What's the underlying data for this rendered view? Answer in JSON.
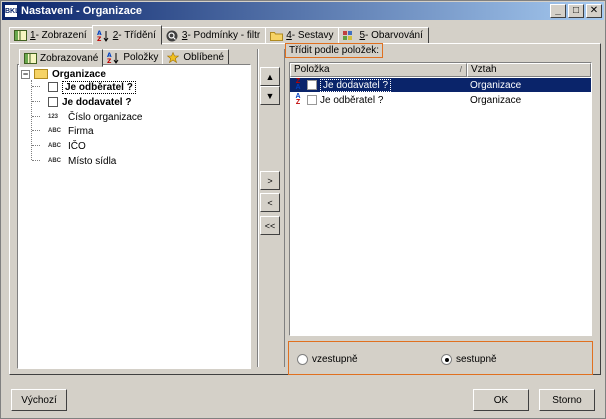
{
  "window": {
    "title": "Nastavení - Organizace",
    "app_icon": "BKL"
  },
  "tabs": [
    {
      "key": "1",
      "label": "- Zobrazení",
      "icon": "columns-icon"
    },
    {
      "key": "2",
      "label": "- Třídění",
      "icon": "sort-az-icon",
      "active": true
    },
    {
      "key": "3",
      "label": "- Podmínky - filtr",
      "icon": "filter-icon"
    },
    {
      "key": "4",
      "label": "- Sestavy",
      "icon": "report-folder-icon"
    },
    {
      "key": "5",
      "label": "- Obarvování",
      "icon": "color-palette-icon"
    }
  ],
  "subtabs": [
    {
      "label": "Zobrazované",
      "active": true
    },
    {
      "label": "Položky"
    },
    {
      "label": "Oblíbené"
    }
  ],
  "tree": {
    "root": "Organizace",
    "items": [
      {
        "label": "Je odběratel ?",
        "kind": "checkbox",
        "bold": true,
        "focused": true
      },
      {
        "label": "Je dodavatel ?",
        "kind": "checkbox",
        "bold": true
      },
      {
        "label": "Číslo organizace",
        "kind": "123"
      },
      {
        "label": "Firma",
        "kind": "ABC"
      },
      {
        "label": "IČO",
        "kind": "ABC"
      },
      {
        "label": "Místo sídla",
        "kind": "ABC"
      }
    ]
  },
  "middle_buttons": {
    "up": "▲",
    "down": "▼",
    "add": ">",
    "remove": "<",
    "remove_all": "<<"
  },
  "sort": {
    "label": "Třídit podle položek:",
    "columns": [
      "Položka",
      "Vztah"
    ],
    "rows": [
      {
        "item": "Je dodavatel ?",
        "relation": "Organizace",
        "direction": "desc",
        "selected": true
      },
      {
        "item": "Je odběratel ?",
        "relation": "Organizace",
        "direction": "asc",
        "selected": false
      }
    ],
    "order_options": [
      {
        "label": "vzestupně",
        "checked": false
      },
      {
        "label": "sestupně",
        "checked": true
      }
    ]
  },
  "buttons": {
    "default": "Výchozí",
    "ok": "OK",
    "cancel": "Storno"
  }
}
